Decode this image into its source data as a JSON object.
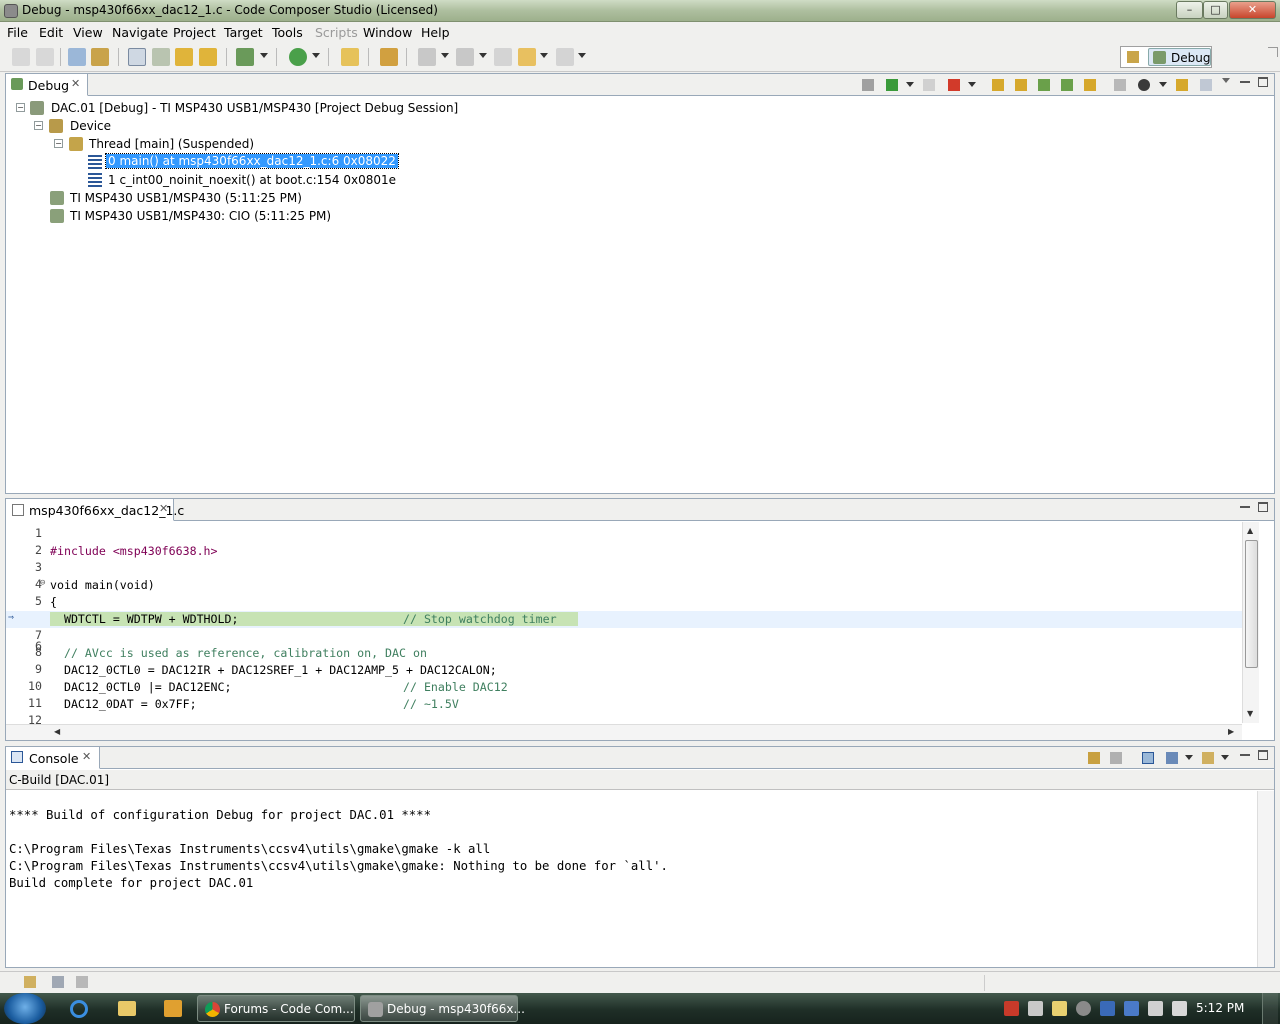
{
  "window": {
    "title": "Debug - msp430f66xx_dac12_1.c - Code Composer Studio (Licensed)",
    "min": "–",
    "max": "□",
    "close": "✕"
  },
  "menu": [
    "File",
    "Edit",
    "View",
    "Navigate",
    "Project",
    "Target",
    "Tools",
    "Scripts",
    "Window",
    "Help"
  ],
  "perspective": {
    "label": "Debug"
  },
  "debug_view": {
    "tab": "Debug",
    "items": [
      {
        "label": "DAC.01 [Debug] - TI MSP430 USB1/MSP430 [Project Debug Session]",
        "icon": "debug-session-icon"
      },
      {
        "label": "Device",
        "icon": "device-icon"
      },
      {
        "label": "Thread [main] (Suspended)",
        "icon": "thread-icon"
      },
      {
        "label": "0 main() at msp430f66xx_dac12_1.c:6 0x08022",
        "icon": "stack-frame-icon"
      },
      {
        "label": "1 c_int00_noinit_noexit() at boot.c:154 0x0801e",
        "icon": "stack-frame-icon"
      },
      {
        "label": "TI MSP430 USB1/MSP430 (5:11:25 PM)",
        "icon": "process-icon"
      },
      {
        "label": "TI MSP430 USB1/MSP430: CIO (5:11:25 PM)",
        "icon": "process-icon"
      }
    ]
  },
  "editor": {
    "tab": "msp430f66xx_dac12_1.c",
    "lines": [
      {
        "n": "1",
        "code": ""
      },
      {
        "n": "2",
        "code": "#include <msp430f6638.h>"
      },
      {
        "n": "3",
        "code": ""
      },
      {
        "n": "4",
        "code": "void main(void)"
      },
      {
        "n": "5",
        "code": "{"
      },
      {
        "n": "6",
        "code": "  WDTCTL = WDTPW + WDTHOLD;",
        "comment": "// Stop watchdog timer"
      },
      {
        "n": "7",
        "code": ""
      },
      {
        "n": "8",
        "code": "",
        "comment": "  // AVcc is used as reference, calibration on, DAC on"
      },
      {
        "n": "9",
        "code": "  DAC12_0CTL0 = DAC12IR + DAC12SREF_1 + DAC12AMP_5 + DAC12CALON;"
      },
      {
        "n": "10",
        "code": "  DAC12_0CTL0 |= DAC12ENC;",
        "comment": "// Enable DAC12"
      },
      {
        "n": "11",
        "code": "  DAC12_0DAT = 0x7FF;",
        "comment": "// ~1.5V"
      },
      {
        "n": "12",
        "code": ""
      }
    ]
  },
  "console": {
    "tab": "Console",
    "subtitle": "C-Build [DAC.01]",
    "lines": [
      "",
      "**** Build of configuration Debug for project DAC.01 ****",
      "",
      "C:\\Program Files\\Texas Instruments\\ccsv4\\utils\\gmake\\gmake -k all",
      "C:\\Program Files\\Texas Instruments\\ccsv4\\utils\\gmake\\gmake: Nothing to be done for `all'.",
      "Build complete for project DAC.01"
    ]
  },
  "taskbar": {
    "apps": [
      {
        "label": "Forums - Code Com...",
        "icon": "chrome-icon"
      },
      {
        "label": "Debug - msp430f66x...",
        "icon": "ccs-icon"
      }
    ],
    "clock": "5:12 PM"
  },
  "colors": {
    "selection": "#3399ff",
    "current_line": "#c7e3b4",
    "keyword": "#7f0055",
    "comment": "#3f7f5f"
  }
}
